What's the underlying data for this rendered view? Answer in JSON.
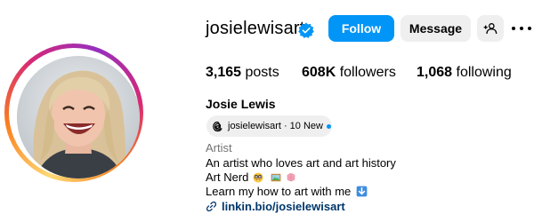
{
  "header": {
    "username": "josielewisart",
    "verified_icon": "verified-badge-icon",
    "follow_label": "Follow",
    "message_label": "Message",
    "add_user_icon": "add-user-icon",
    "more_icon": "more-options-icon"
  },
  "stats": {
    "posts_count": "3,165",
    "posts_label": "posts",
    "followers_count": "608K",
    "followers_label": "followers",
    "following_count": "1,068",
    "following_label": "following"
  },
  "profile": {
    "full_name": "Josie Lewis",
    "threads_handle": "josielewisart · 10 New",
    "threads_icon": "threads-icon",
    "category": "Artist",
    "bio_line_1": "An artist who loves art and art history",
    "bio_line_2": "Art Nerd",
    "bio_line_2_emojis": [
      "nerd-face-emoji",
      "framed-picture-emoji",
      "brain-emoji"
    ],
    "bio_line_3": "Learn my how to art with me",
    "bio_line_3_emoji": "down-arrow-emoji",
    "link_text": "linkin.bio/josielewisart",
    "link_icon": "link-icon"
  },
  "colors": {
    "accent_blue": "#0095f6",
    "button_grey": "#efefef",
    "link_blue": "#00376b",
    "muted_text": "#737373"
  }
}
